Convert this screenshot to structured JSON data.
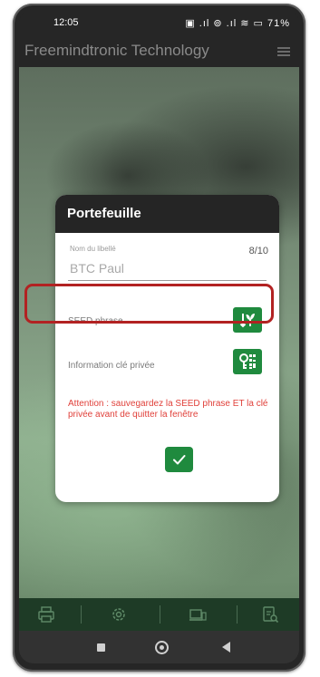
{
  "status_bar": {
    "time": "12:05",
    "icons_text": "▣ .ıl ⊚ .ıl ≋ ▭ 71%"
  },
  "app_bar": {
    "title": "Freemindtronic Technology",
    "menu_icon": "hamburger-icon"
  },
  "dialog": {
    "title": "Portefeuille",
    "name_label": "Nom du libellé",
    "name_value": "BTC Paul",
    "counter": "8/10",
    "seed_label": "SEED phrase",
    "seed_icon": "seed-sprout-icon",
    "private_label": "Information clé privée",
    "private_icon": "key-qr-icon",
    "warning": "Attention : sauvegardez la SEED phrase ET la clé privée avant de quitter la fenêtre",
    "confirm_icon": "checkmark-icon"
  },
  "colors": {
    "accent_green": "#1f8a3e",
    "warning_red": "#e0403a",
    "highlight_red": "#b22222",
    "tabbar_green": "#1e3b26"
  },
  "tab_bar": {
    "items": [
      "printer-icon",
      "settings-icon",
      "devices-icon",
      "document-search-icon"
    ]
  },
  "nav_bar": {
    "items": [
      "recents-icon",
      "home-icon",
      "back-icon"
    ]
  }
}
